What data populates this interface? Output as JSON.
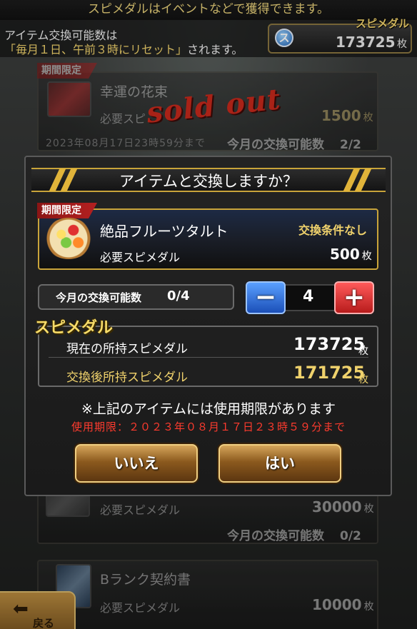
{
  "top_banner": "スピメダルはイベントなどで獲得できます。",
  "header": {
    "line1": "アイテム交換可能数は",
    "line2_highlight": "「毎月１日、午前３時にリセット」",
    "line2_rest": "されます。",
    "medal_label": "スピメダル",
    "medal_icon_text": "ス",
    "medal_value": "173725",
    "medal_unit": "枚"
  },
  "cards": [
    {
      "tag": "期間限定",
      "name": "幸運の花束",
      "req_label": "必要スピ",
      "price": "1500",
      "unit": "枚",
      "date": "2023年08月17日23時59分まで",
      "count_label": "今月の交換可能数",
      "count": "2/2",
      "sold_out": "sold out"
    },
    {
      "req_label": "必要スピメダル",
      "price": "30000",
      "unit": "枚",
      "count_label": "今月の交換可能数",
      "count": "0/2"
    },
    {
      "name": "Bランク契約書",
      "req_label": "必要スピメダル",
      "price": "10000",
      "unit": "枚"
    }
  ],
  "back_button": "戻る",
  "dialog": {
    "title": "アイテムと交換しますか？",
    "item": {
      "tag": "期間限定",
      "name": "絶品フルーツタルト",
      "condition": "交換条件なし",
      "req_label": "必要スピメダル",
      "price": "500",
      "unit": "枚"
    },
    "monthly_label": "今月の交換可能数",
    "monthly_value": "0/4",
    "quantity": "4",
    "minus_label": "−",
    "plus_label": "+",
    "section_title": "スピメダル",
    "current_label": "現在の所持スピメダル",
    "current_value": "173725",
    "after_label": "交換後所持スピメダル",
    "after_value": "171725",
    "unit": "枚",
    "notice": "※上記のアイテムには使用期限があります",
    "expiry": "使用期限：２０２３年０８月１７日２３時５９分まで",
    "no_label": "いいえ",
    "yes_label": "はい"
  },
  "colors": {
    "gold": "#f0d26c",
    "red_text": "#ff3b2e",
    "tag_red": "#b42020"
  }
}
